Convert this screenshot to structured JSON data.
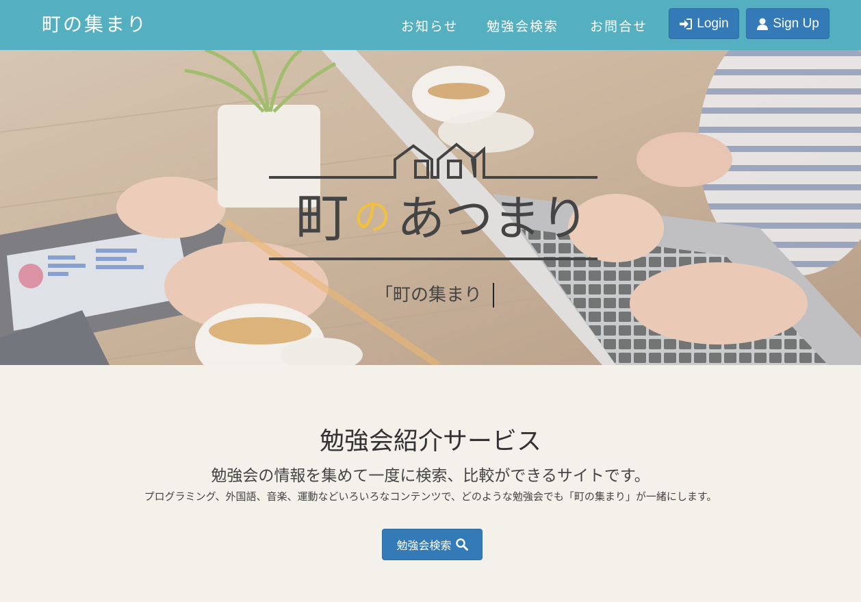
{
  "header": {
    "brand": "町の集まり",
    "nav": [
      "お知らせ",
      "勉強会検索",
      "お問合せ"
    ],
    "login_label": "Login",
    "signup_label": "Sign Up"
  },
  "hero": {
    "logo_text_1": "町",
    "logo_text_2": "の",
    "logo_text_3": "あつまり",
    "typed_text": "「町の集まり"
  },
  "main": {
    "title": "勉強会紹介サービス",
    "subtitle": "勉強会の情報を集めて一度に検索、比較ができるサイトです。",
    "description": "プログラミング、外国語、音楽、運動などいろいろなコンテンツで、どのような勉強会でも「町の集まり」が一緒にします。",
    "search_button": "勉強会検索"
  },
  "colors": {
    "navbar": "#54b0c0",
    "button": "#337ab7",
    "background": "#f4f1ea",
    "logo_accent": "#f0c040"
  },
  "icons": [
    "login-icon",
    "user-icon",
    "search-icon"
  ]
}
